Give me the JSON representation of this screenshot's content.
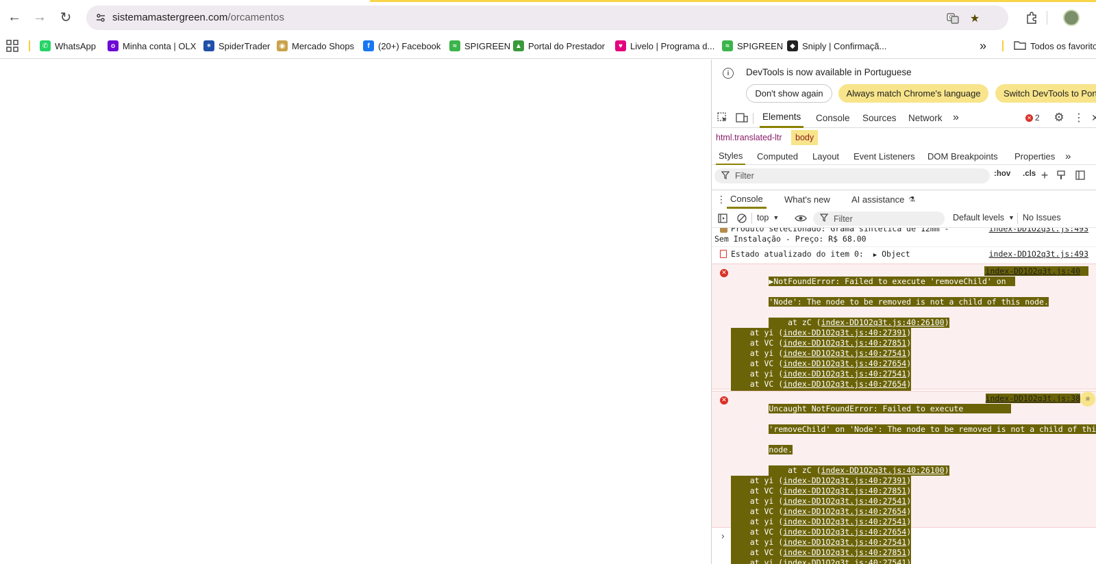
{
  "browser": {
    "url_domain": "sistemamastergreen.com",
    "url_path": "/orcamentos"
  },
  "bookmarks": [
    {
      "label": "WhatsApp",
      "icon": "whatsapp-icon",
      "color": "#25d366"
    },
    {
      "label": "Minha conta | OLX",
      "icon": "olx-icon",
      "color": "#6e0ad6"
    },
    {
      "label": "SpiderTrader",
      "icon": "spidertrader-icon",
      "color": "#1f4fa8"
    },
    {
      "label": "Mercado Shops",
      "icon": "mercado-shops-icon",
      "color": "#c9a24a"
    },
    {
      "label": "(20+) Facebook",
      "icon": "facebook-icon",
      "color": "#1877f2"
    },
    {
      "label": "SPIGREEN",
      "icon": "spigreen-icon",
      "color": "#3bb54a"
    },
    {
      "label": "Portal do Prestador",
      "icon": "portal-icon",
      "color": "#3a9a3a"
    },
    {
      "label": "Livelo | Programa d...",
      "icon": "livelo-icon",
      "color": "#e4007c"
    },
    {
      "label": "SPIGREEN",
      "icon": "spigreen-icon",
      "color": "#3bb54a"
    },
    {
      "label": "Sniply | Confirmaçã...",
      "icon": "sniply-icon",
      "color": "#222222"
    }
  ],
  "bookmarks_more": "»",
  "bookmarks_folder": "Todos os favoritos",
  "devtools": {
    "info_text": "DevTools is now available in Portuguese",
    "btn_dont_show": "Don't show again",
    "btn_always_match": "Always match Chrome's language",
    "btn_switch": "Switch DevTools to Portuguese",
    "tabs": [
      "Elements",
      "Console",
      "Sources",
      "Network"
    ],
    "error_count": "2",
    "breadcrumb_html": "html.translated-ltr",
    "breadcrumb_body": "body",
    "subtabs": [
      "Styles",
      "Computed",
      "Layout",
      "Event Listeners",
      "DOM Breakpoints",
      "Properties"
    ],
    "styles_filter": "Filter",
    "hov": ":hov",
    "cls": ".cls",
    "drawer_tabs": [
      "Console",
      "What's new",
      "AI assistance"
    ],
    "console_context": "top",
    "console_filter": "Filter",
    "default_levels": "Default levels",
    "no_issues": "No Issues"
  },
  "console": {
    "msg1_line1": "Produto selecionado: Grama sintética de 12mm -",
    "msg1_line2": "Sem Instalação - Preço: R$ 68.00",
    "msg1_src": "index-DD1O2q3t.js:493",
    "msg2_text": "Estado atualizado do item 0:",
    "msg2_obj": "Object",
    "msg2_src": "index-DD1O2q3t.js:493",
    "err1_line1": "NotFoundError: Failed to execute 'removeChild' on",
    "err1_line2": "'Node': The node to be removed is not a child of this node.",
    "err1_src": "index-DD1O2q3t.js:40",
    "err2_line1": "Uncaught NotFoundError: Failed to execute",
    "err2_line2": "'removeChild' on 'Node': The node to be removed is not a child of this",
    "err2_line3": "node.",
    "err2_src": "index-DD1O2q3t.js:38",
    "stack": [
      {
        "fn": "zC",
        "loc": "index-DD1O2q3t.js:40:26100"
      },
      {
        "fn": "yi",
        "loc": "index-DD1O2q3t.js:40:27391"
      },
      {
        "fn": "VC",
        "loc": "index-DD1O2q3t.js:40:27851"
      },
      {
        "fn": "yi",
        "loc": "index-DD1O2q3t.js:40:27541"
      },
      {
        "fn": "VC",
        "loc": "index-DD1O2q3t.js:40:27654"
      },
      {
        "fn": "yi",
        "loc": "index-DD1O2q3t.js:40:27541"
      },
      {
        "fn": "VC",
        "loc": "index-DD1O2q3t.js:40:27654"
      },
      {
        "fn": "yi",
        "loc": "index-DD1O2q3t.js:40:27541"
      },
      {
        "fn": "VC",
        "loc": "index-DD1O2q3t.js:40:27851"
      },
      {
        "fn": "yi",
        "loc": "index-DD1O2q3t.js:40:27541"
      }
    ]
  }
}
